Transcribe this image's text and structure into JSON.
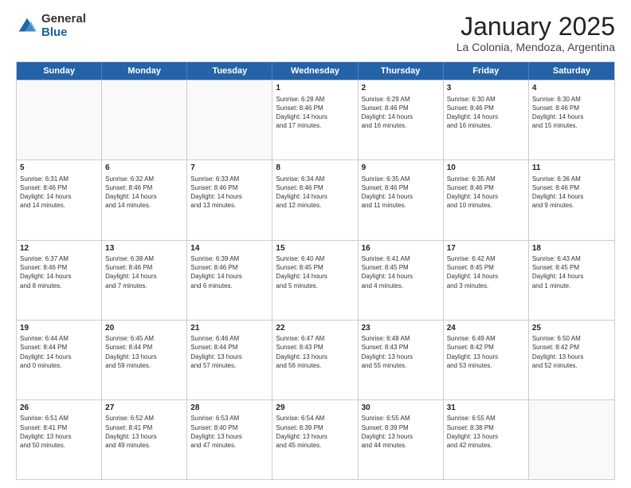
{
  "logo": {
    "general": "General",
    "blue": "Blue"
  },
  "title": "January 2025",
  "subtitle": "La Colonia, Mendoza, Argentina",
  "header_days": [
    "Sunday",
    "Monday",
    "Tuesday",
    "Wednesday",
    "Thursday",
    "Friday",
    "Saturday"
  ],
  "weeks": [
    [
      {
        "day": "",
        "text": "",
        "empty": true
      },
      {
        "day": "",
        "text": "",
        "empty": true
      },
      {
        "day": "",
        "text": "",
        "empty": true
      },
      {
        "day": "1",
        "text": "Sunrise: 6:28 AM\nSunset: 8:46 PM\nDaylight: 14 hours\nand 17 minutes.",
        "empty": false
      },
      {
        "day": "2",
        "text": "Sunrise: 6:29 AM\nSunset: 8:46 PM\nDaylight: 14 hours\nand 16 minutes.",
        "empty": false
      },
      {
        "day": "3",
        "text": "Sunrise: 6:30 AM\nSunset: 8:46 PM\nDaylight: 14 hours\nand 16 minutes.",
        "empty": false
      },
      {
        "day": "4",
        "text": "Sunrise: 6:30 AM\nSunset: 8:46 PM\nDaylight: 14 hours\nand 15 minutes.",
        "empty": false
      }
    ],
    [
      {
        "day": "5",
        "text": "Sunrise: 6:31 AM\nSunset: 8:46 PM\nDaylight: 14 hours\nand 14 minutes.",
        "empty": false
      },
      {
        "day": "6",
        "text": "Sunrise: 6:32 AM\nSunset: 8:46 PM\nDaylight: 14 hours\nand 14 minutes.",
        "empty": false
      },
      {
        "day": "7",
        "text": "Sunrise: 6:33 AM\nSunset: 8:46 PM\nDaylight: 14 hours\nand 13 minutes.",
        "empty": false
      },
      {
        "day": "8",
        "text": "Sunrise: 6:34 AM\nSunset: 8:46 PM\nDaylight: 14 hours\nand 12 minutes.",
        "empty": false
      },
      {
        "day": "9",
        "text": "Sunrise: 6:35 AM\nSunset: 8:46 PM\nDaylight: 14 hours\nand 11 minutes.",
        "empty": false
      },
      {
        "day": "10",
        "text": "Sunrise: 6:35 AM\nSunset: 8:46 PM\nDaylight: 14 hours\nand 10 minutes.",
        "empty": false
      },
      {
        "day": "11",
        "text": "Sunrise: 6:36 AM\nSunset: 8:46 PM\nDaylight: 14 hours\nand 9 minutes.",
        "empty": false
      }
    ],
    [
      {
        "day": "12",
        "text": "Sunrise: 6:37 AM\nSunset: 8:46 PM\nDaylight: 14 hours\nand 8 minutes.",
        "empty": false
      },
      {
        "day": "13",
        "text": "Sunrise: 6:38 AM\nSunset: 8:46 PM\nDaylight: 14 hours\nand 7 minutes.",
        "empty": false
      },
      {
        "day": "14",
        "text": "Sunrise: 6:39 AM\nSunset: 8:46 PM\nDaylight: 14 hours\nand 6 minutes.",
        "empty": false
      },
      {
        "day": "15",
        "text": "Sunrise: 6:40 AM\nSunset: 8:45 PM\nDaylight: 14 hours\nand 5 minutes.",
        "empty": false
      },
      {
        "day": "16",
        "text": "Sunrise: 6:41 AM\nSunset: 8:45 PM\nDaylight: 14 hours\nand 4 minutes.",
        "empty": false
      },
      {
        "day": "17",
        "text": "Sunrise: 6:42 AM\nSunset: 8:45 PM\nDaylight: 14 hours\nand 3 minutes.",
        "empty": false
      },
      {
        "day": "18",
        "text": "Sunrise: 6:43 AM\nSunset: 8:45 PM\nDaylight: 14 hours\nand 1 minute.",
        "empty": false
      }
    ],
    [
      {
        "day": "19",
        "text": "Sunrise: 6:44 AM\nSunset: 8:44 PM\nDaylight: 14 hours\nand 0 minutes.",
        "empty": false
      },
      {
        "day": "20",
        "text": "Sunrise: 6:45 AM\nSunset: 8:44 PM\nDaylight: 13 hours\nand 59 minutes.",
        "empty": false
      },
      {
        "day": "21",
        "text": "Sunrise: 6:46 AM\nSunset: 8:44 PM\nDaylight: 13 hours\nand 57 minutes.",
        "empty": false
      },
      {
        "day": "22",
        "text": "Sunrise: 6:47 AM\nSunset: 8:43 PM\nDaylight: 13 hours\nand 56 minutes.",
        "empty": false
      },
      {
        "day": "23",
        "text": "Sunrise: 6:48 AM\nSunset: 8:43 PM\nDaylight: 13 hours\nand 55 minutes.",
        "empty": false
      },
      {
        "day": "24",
        "text": "Sunrise: 6:49 AM\nSunset: 8:42 PM\nDaylight: 13 hours\nand 53 minutes.",
        "empty": false
      },
      {
        "day": "25",
        "text": "Sunrise: 6:50 AM\nSunset: 8:42 PM\nDaylight: 13 hours\nand 52 minutes.",
        "empty": false
      }
    ],
    [
      {
        "day": "26",
        "text": "Sunrise: 6:51 AM\nSunset: 8:41 PM\nDaylight: 13 hours\nand 50 minutes.",
        "empty": false
      },
      {
        "day": "27",
        "text": "Sunrise: 6:52 AM\nSunset: 8:41 PM\nDaylight: 13 hours\nand 49 minutes.",
        "empty": false
      },
      {
        "day": "28",
        "text": "Sunrise: 6:53 AM\nSunset: 8:40 PM\nDaylight: 13 hours\nand 47 minutes.",
        "empty": false
      },
      {
        "day": "29",
        "text": "Sunrise: 6:54 AM\nSunset: 8:39 PM\nDaylight: 13 hours\nand 45 minutes.",
        "empty": false
      },
      {
        "day": "30",
        "text": "Sunrise: 6:55 AM\nSunset: 8:39 PM\nDaylight: 13 hours\nand 44 minutes.",
        "empty": false
      },
      {
        "day": "31",
        "text": "Sunrise: 6:55 AM\nSunset: 8:38 PM\nDaylight: 13 hours\nand 42 minutes.",
        "empty": false
      },
      {
        "day": "",
        "text": "",
        "empty": true
      }
    ]
  ]
}
